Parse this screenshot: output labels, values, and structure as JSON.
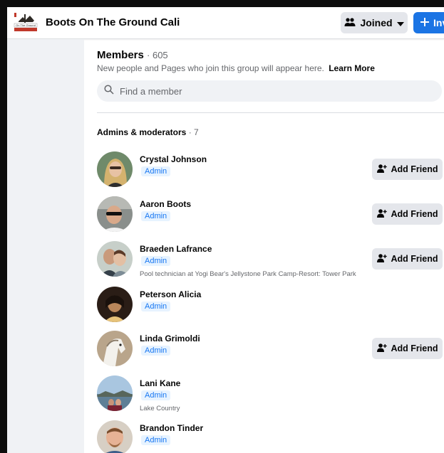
{
  "header": {
    "group_name": "Boots On The Ground Cali",
    "logo_caption": "On The Ground",
    "joined_label": "Joined",
    "invite_label": "Inv"
  },
  "members_section": {
    "title": "Members",
    "count": "· 605",
    "description": "New people and Pages who join this group will appear here.",
    "learn_more": "Learn More",
    "search_placeholder": "Find a member"
  },
  "admins_section": {
    "title": "Admins & moderators",
    "count": "· 7"
  },
  "members": [
    {
      "name": "Crystal Johnson",
      "role": "Admin",
      "subtitle": "",
      "add_friend": "Add Friend",
      "avatar": "woman-blonde"
    },
    {
      "name": "Aaron Boots",
      "role": "Admin",
      "subtitle": "",
      "add_friend": "Add Friend",
      "avatar": "man-sunglasses"
    },
    {
      "name": "Braeden Lafrance",
      "role": "Admin",
      "subtitle": "Pool technician at Yogi Bear's Jellystone Park Camp-Resort: Tower Park",
      "add_friend": "Add Friend",
      "avatar": "couple"
    },
    {
      "name": "Peterson Alicia",
      "role": "Admin",
      "subtitle": "",
      "add_friend": "",
      "avatar": "dark-portrait"
    },
    {
      "name": "Linda Grimoldi",
      "role": "Admin",
      "subtitle": "",
      "add_friend": "Add Friend",
      "avatar": "white-horse"
    },
    {
      "name": "Lani Kane",
      "role": "Admin",
      "subtitle": "Lake Country",
      "add_friend": "",
      "avatar": "lake"
    },
    {
      "name": "Brandon Tinder",
      "role": "Admin",
      "subtitle": "",
      "add_friend": "",
      "avatar": "man-smiling"
    }
  ],
  "colors": {
    "accent_blue": "#1b74e4",
    "badge_text": "#1877f2",
    "badge_bg": "#e7f3ff",
    "button_gray": "#e4e6eb",
    "sidebar_bg": "#f0f2f5"
  }
}
